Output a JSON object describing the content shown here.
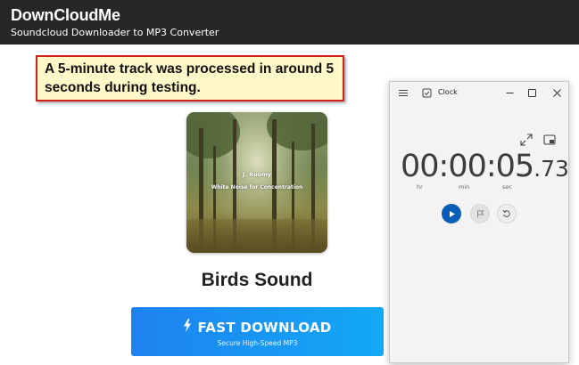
{
  "header": {
    "brand": "DownCloudMe",
    "tagline": "Soundcloud Downloader to MP3 Converter"
  },
  "note": {
    "text": "A 5-minute track was processed in around 5 seconds during testing."
  },
  "track": {
    "artist": "J. Roomy",
    "album_text": "White Noise for Concentration",
    "title": "Birds Sound"
  },
  "download": {
    "label": "FAST DOWNLOAD",
    "sublabel": "Secure High-Speed MP3"
  },
  "clock_window": {
    "title": "Clock",
    "stopwatch": {
      "main": "00:00:05",
      "fraction": ".73",
      "units": {
        "hr": "hr",
        "min": "min",
        "sec": "sec"
      }
    },
    "icons": [
      "hamburger-icon",
      "clock-app-icon",
      "minimize-icon",
      "maximize-icon",
      "close-icon",
      "expand-icon",
      "compact-overlay-icon",
      "play-icon",
      "flag-icon",
      "reset-icon"
    ]
  },
  "colors": {
    "header_bg": "#272727",
    "note_bg": "#fff8c8",
    "note_border": "#cf2020",
    "download_gradient_start": "#1e82f0",
    "download_gradient_end": "#13a9f6",
    "play_accent": "#0a5eb5"
  }
}
